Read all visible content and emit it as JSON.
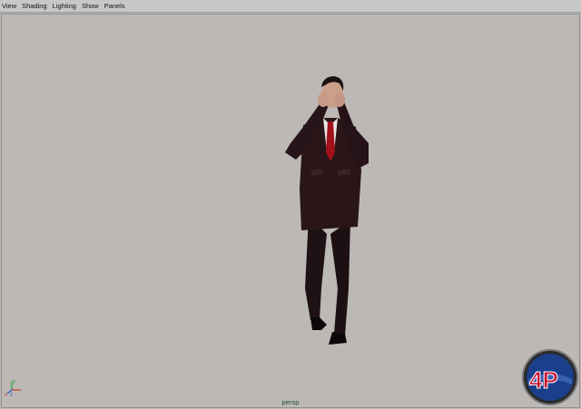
{
  "menubar": {
    "items": [
      "View",
      "Shading",
      "Lighting",
      "Show",
      "Panels"
    ]
  },
  "viewport": {
    "camera_label": "persp",
    "background_color": "#bcb8b6"
  },
  "axis_indicator": {
    "x_label": "x",
    "y_label": "y",
    "z_label": "z"
  },
  "logo": {
    "text": "4P",
    "brand_colors": [
      "#c8102e",
      "#1b3f8b"
    ]
  },
  "model": {
    "icon": "man-in-suit-shouting"
  }
}
